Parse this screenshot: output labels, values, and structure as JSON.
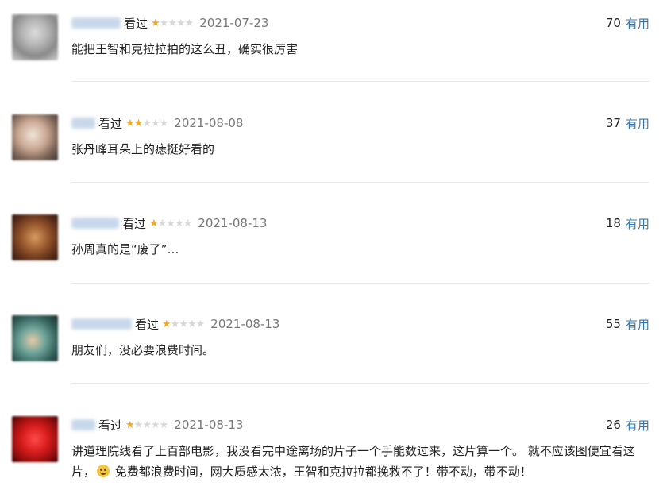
{
  "colors": {
    "star_filled": "#f5a623",
    "star_empty": "#d8d8d8",
    "link": "#3377aa",
    "date": "#777777"
  },
  "comments": [
    {
      "status": "看过",
      "rating_stars": 1,
      "date": "2021-07-23",
      "votes": "70",
      "vote_label": "有用",
      "text": "能把王智和克拉拉拍的这么丑，确实很厉害"
    },
    {
      "status": "看过",
      "rating_stars": 2,
      "date": "2021-08-08",
      "votes": "37",
      "vote_label": "有用",
      "text": "张丹峰耳朵上的痣挺好看的"
    },
    {
      "status": "看过",
      "rating_stars": 1,
      "date": "2021-08-13",
      "votes": "18",
      "vote_label": "有用",
      "text": "孙周真的是“废了”…"
    },
    {
      "status": "看过",
      "rating_stars": 1,
      "date": "2021-08-13",
      "votes": "55",
      "vote_label": "有用",
      "text": "朋友们，没必要浪费时间。"
    },
    {
      "status": "看过",
      "rating_stars": 1,
      "date": "2021-08-13",
      "votes": "26",
      "vote_label": "有用",
      "text_before_emoji": "讲道理院线看了上百部电影，我没看完中途离场的片子一个手能数过来，这片算一个。 就不应该图便宜看这片，",
      "emoji_icon": "laughing-tears-emoji-icon",
      "text_after_emoji": " 免费都浪费时间，网大质感太浓，王智和克拉拉都挽救不了！带不动，带不动！"
    }
  ]
}
